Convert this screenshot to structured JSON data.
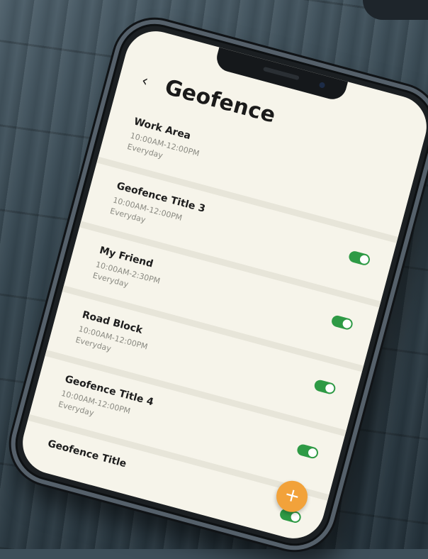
{
  "header": {
    "back_icon": "chevron-left-icon",
    "back_glyph": "‹",
    "title": "Geofence"
  },
  "geofences": [
    {
      "title": "Work Area",
      "time": "10:00AM-12:00PM",
      "days": "Everyday",
      "toggle_on": false
    },
    {
      "title": "Geofence Title 3",
      "time": "10:00AM-12:00PM",
      "days": "Everyday",
      "toggle_on": true
    },
    {
      "title": "My Friend",
      "time": "10:00AM-2:30PM",
      "days": "Everyday",
      "toggle_on": true
    },
    {
      "title": "Road Block",
      "time": "10:00AM-12:00PM",
      "days": "Everyday",
      "toggle_on": true
    },
    {
      "title": "Geofence Title 4",
      "time": "10:00AM-12:00PM",
      "days": "Everyday",
      "toggle_on": true
    },
    {
      "title": "Geofence Title",
      "time": "",
      "days": "",
      "toggle_on": true
    }
  ],
  "fab": {
    "icon": "plus-icon",
    "glyph": "+"
  },
  "colors": {
    "screen_bg": "#f6f4ea",
    "toggle_on": "#2e9a45",
    "fab": "#f2a23a"
  }
}
